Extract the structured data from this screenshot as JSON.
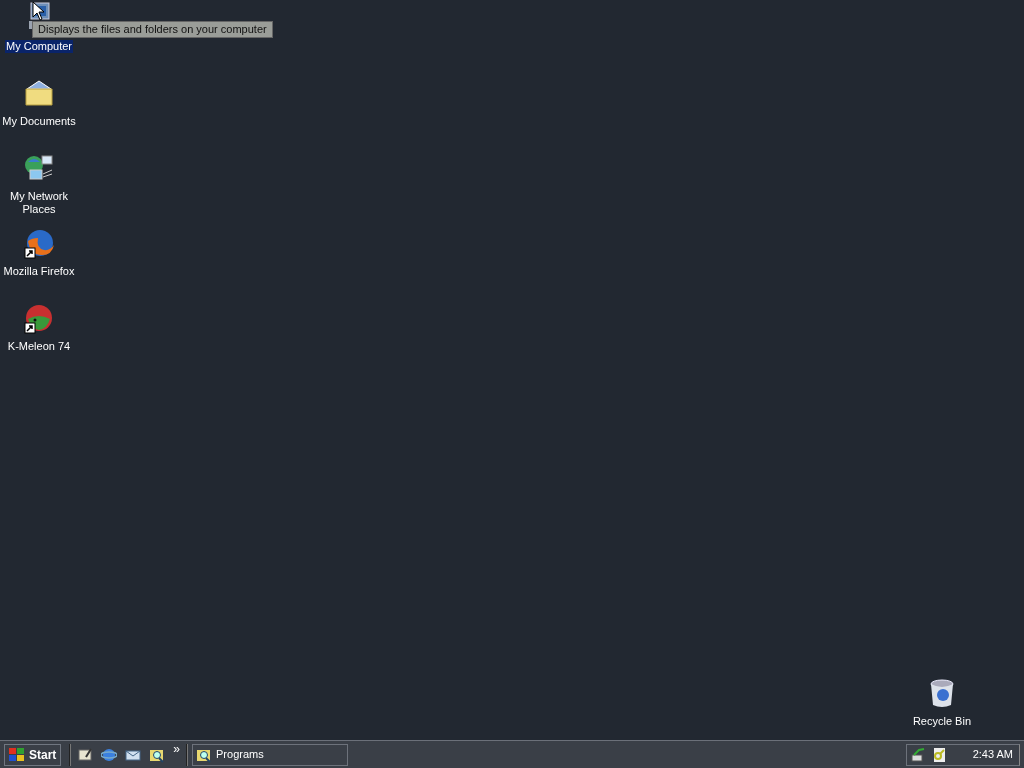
{
  "desktop_icons": [
    {
      "kind": "computer",
      "label": "My Computer",
      "selected": true,
      "shortcut": false
    },
    {
      "kind": "documents",
      "label": "My Documents",
      "selected": false,
      "shortcut": false
    },
    {
      "kind": "network",
      "label": "My Network Places",
      "selected": false,
      "shortcut": false
    },
    {
      "kind": "firefox",
      "label": "Mozilla Firefox",
      "selected": false,
      "shortcut": true
    },
    {
      "kind": "kmeleon",
      "label": "K-Meleon 74",
      "selected": false,
      "shortcut": true
    }
  ],
  "recycle_bin": {
    "kind": "recycle",
    "label": "Recycle Bin",
    "selected": false,
    "shortcut": false
  },
  "tooltip": "Displays the files and folders on your computer",
  "taskbar": {
    "start_label": "Start",
    "quick_launch": [
      {
        "kind": "desktop"
      },
      {
        "kind": "ie"
      },
      {
        "kind": "mail"
      },
      {
        "kind": "search"
      }
    ],
    "overflow": "»",
    "windows": [
      {
        "label": "Programs",
        "selected": false
      }
    ],
    "tray": [
      {
        "kind": "network"
      },
      {
        "kind": "key"
      }
    ],
    "clock": "2:43 AM"
  }
}
